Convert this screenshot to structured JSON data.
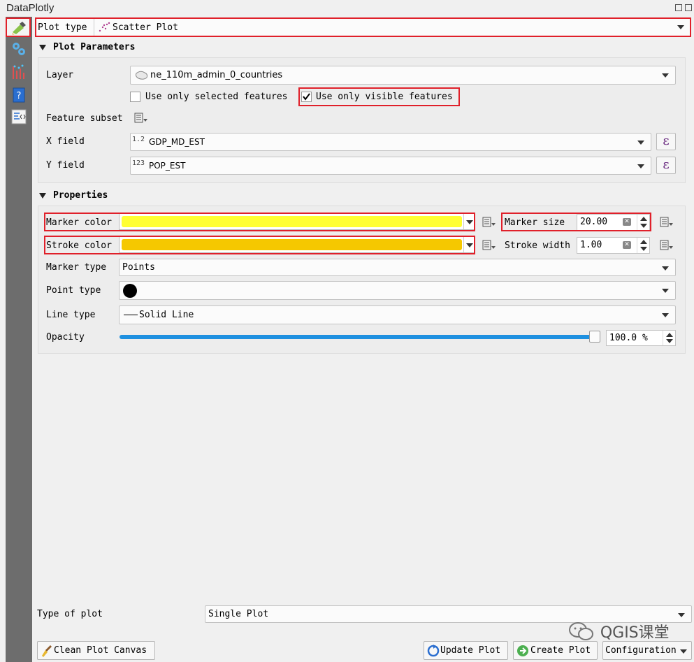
{
  "window": {
    "title": "DataPlotly"
  },
  "plot_type": {
    "label": "Plot type",
    "value": "Scatter Plot"
  },
  "plot_parameters": {
    "header": "Plot Parameters",
    "layer_label": "Layer",
    "layer_value": "ne_110m_admin_0_countries",
    "use_selected_label": "Use only selected features",
    "use_selected_checked": false,
    "use_visible_label": "Use only visible features",
    "use_visible_checked": true,
    "feature_subset_label": "Feature subset",
    "x_field_label": "X field",
    "x_field_type": "1.2",
    "x_field_value": "GDP_MD_EST",
    "y_field_label": "Y field",
    "y_field_type": "123",
    "y_field_value": "POP_EST",
    "expression_symbol": "ε"
  },
  "properties": {
    "header": "Properties",
    "marker_color_label": "Marker color",
    "marker_color": "#ffff33",
    "stroke_color_label": "Stroke color",
    "stroke_color": "#f5c800",
    "marker_size_label": "Marker size",
    "marker_size_value": "20.00",
    "stroke_width_label": "Stroke width",
    "stroke_width_value": "1.00",
    "marker_type_label": "Marker type",
    "marker_type_value": "Points",
    "point_type_label": "Point type",
    "line_type_label": "Line type",
    "line_type_value": "Solid Line",
    "opacity_label": "Opacity",
    "opacity_value": "100.0 %",
    "opacity_fraction": 1.0
  },
  "footer": {
    "type_of_plot_label": "Type of plot",
    "type_of_plot_value": "Single Plot",
    "clean_button": "Clean Plot Canvas",
    "update_button": "Update Plot",
    "create_button": "Create Plot",
    "configuration_button": "Configuration"
  },
  "watermark": "QGIS课堂",
  "colors": {
    "highlight": "#e0202a",
    "slider": "#1e90e0",
    "sidebar": "#6d6d6d"
  }
}
